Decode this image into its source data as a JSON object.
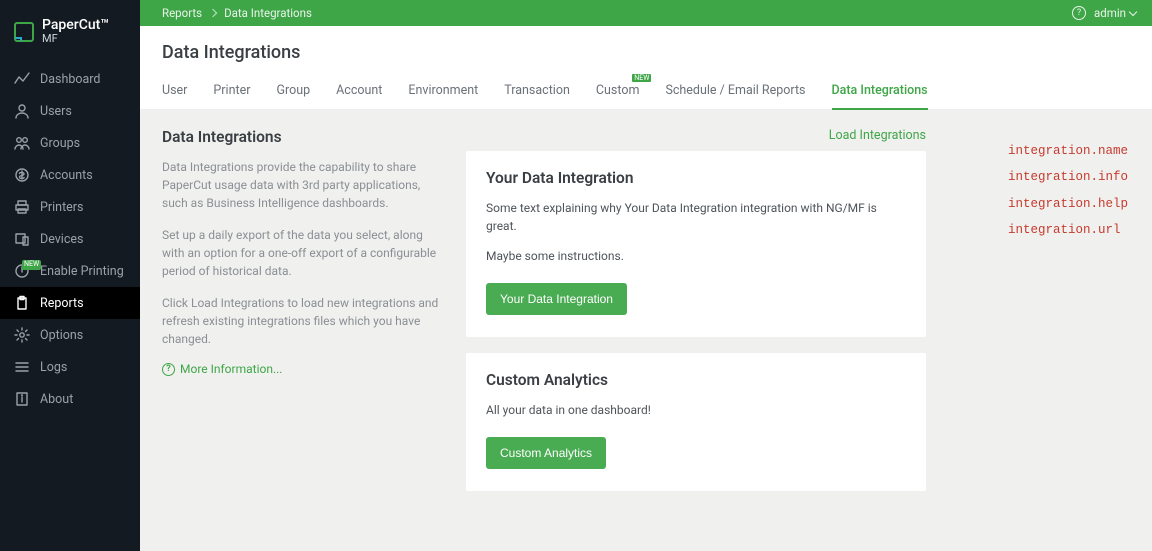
{
  "brand": {
    "name": "PaperCut",
    "sub": "MF"
  },
  "sidebar": {
    "items": [
      {
        "label": "Dashboard",
        "icon": "dashboard"
      },
      {
        "label": "Users",
        "icon": "user"
      },
      {
        "label": "Groups",
        "icon": "groups"
      },
      {
        "label": "Accounts",
        "icon": "accounts"
      },
      {
        "label": "Printers",
        "icon": "printer"
      },
      {
        "label": "Devices",
        "icon": "device"
      },
      {
        "label": "Enable Printing",
        "icon": "enable",
        "badge": "NEW"
      },
      {
        "label": "Reports",
        "icon": "reports",
        "active": true
      },
      {
        "label": "Options",
        "icon": "options"
      },
      {
        "label": "Logs",
        "icon": "logs"
      },
      {
        "label": "About",
        "icon": "about"
      }
    ]
  },
  "topbar": {
    "crumb1": "Reports",
    "crumb2": "Data Integrations",
    "user": "admin"
  },
  "page": {
    "title": "Data Integrations"
  },
  "tabs": [
    {
      "label": "User"
    },
    {
      "label": "Printer"
    },
    {
      "label": "Group"
    },
    {
      "label": "Account"
    },
    {
      "label": "Environment"
    },
    {
      "label": "Transaction"
    },
    {
      "label": "Custom",
      "badge": "NEW"
    },
    {
      "label": "Schedule / Email Reports"
    },
    {
      "label": "Data Integrations",
      "active": true
    }
  ],
  "left": {
    "title": "Data Integrations",
    "p1": "Data Integrations provide the capability to share PaperCut usage data with 3rd party applications, such as Business Intelligence dashboards.",
    "p2": "Set up a daily export of the data you select, along with an option for a one-off export of a configurable period of historical data.",
    "p3": "Click Load Integrations to load new integrations and refresh existing integrations files which you have changed.",
    "more": "More Information..."
  },
  "center": {
    "load_link": "Load Integrations",
    "cards": [
      {
        "title": "Your Data Integration",
        "p1": "Some text explaining why Your Data Integration integration with NG/MF is great.",
        "p2": "Maybe some instructions.",
        "button": "Your Data Integration"
      },
      {
        "title": "Custom Analytics",
        "p1": "All your data in one dashboard!",
        "p2": "",
        "button": "Custom Analytics"
      }
    ]
  },
  "annotations": [
    "integration.name",
    "integration.info",
    "integration.help",
    "integration.url"
  ]
}
